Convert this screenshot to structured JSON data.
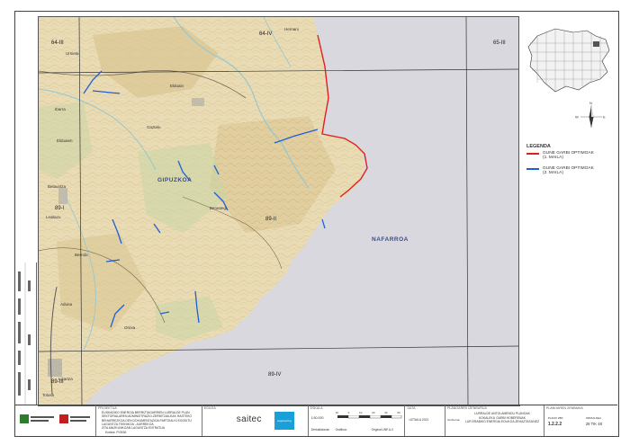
{
  "map": {
    "sheet_labels": {
      "nw": "64-III",
      "n": "64-IV",
      "ne": "65-III",
      "w": "89-I",
      "center": "89-II",
      "sw": "89-III",
      "s": "89-IV"
    },
    "regions": {
      "gipuzkoa": "GIPUZKOA",
      "nafarroa": "NAFARROA"
    },
    "places": [
      "Hernani",
      "Urnieta",
      "Elduain",
      "Berastegi",
      "Leaburu",
      "Lizartza",
      "Orexa",
      "Belauntza",
      "Tolosa",
      "Ibarra",
      "Gaztelu",
      "Berrobi",
      "Elduaien",
      "Aduna"
    ]
  },
  "legend": {
    "title": "LEGENDA",
    "items": [
      {
        "label_1": "GUNE GARBI OPTIMOAK",
        "label_2": "(1. MAILA)",
        "color": "#e02020"
      },
      {
        "label_1": "GUNE GARBI OPTIMOAK",
        "label_2": "(2. MAILA)",
        "color": "#1f5fd6"
      }
    ]
  },
  "titleblock": {
    "proiektua_head": "PROIEKTUA",
    "proiektua_lines": [
      "EUSKADIKO ENERGIA BERRIZTAGARRIEN LURRALDE PLAN",
      "SEKTORIALAREN ADMINISTRAZIO-ZERBITZAILEAK HASTEKO",
      "BEHARREZKOA DEN DOKUMENTAZIOA PARTZIALKI EGOKITU",
      "LAGUNTZA TEKNIKOA - AURREKOA",
      "ZITA ANIZKUNKOAN LAGUNTZA ENTRATUA"
    ],
    "kodea": "Kodea:  P.0536",
    "egilea_head": "EGILEA",
    "egilea_name": "saitec",
    "egilea_badge": "engineering",
    "eskala_head": "ESKALA",
    "eskala_value": "1:50.000",
    "scale_ticks": [
      "10",
      "0",
      "10",
      "20",
      "40",
      "60"
    ],
    "zenbakidunak": "Zenbakidunak:",
    "grafikoa": "Grafikoa:",
    "original": "Original UNE A-3",
    "data_head": "DATA",
    "data_value": "UZTAILA 2021",
    "planoaren_izenburua_head": "PLANOAREN IZENBURUA",
    "planoaren_lines": [
      "LURRALDE ANTOLAMENDU PLANOAK",
      "KOKALEKU GARBI HOBERENAK",
      "LUR ERABIKO ENERGIA EOLIKOA ZEHAZTASUNEZ"
    ],
    "izenburua_sub": "Izenburua:",
    "planoaren_zenbakia_head": "PLANOAREN ZENBAKIA",
    "plano_zbk_head": "PLANO ZBK",
    "plano_zbk": "1.2.2.2",
    "orrialdea_head": "ORRIALDEA",
    "orrialdea": "28 TIK 48"
  }
}
